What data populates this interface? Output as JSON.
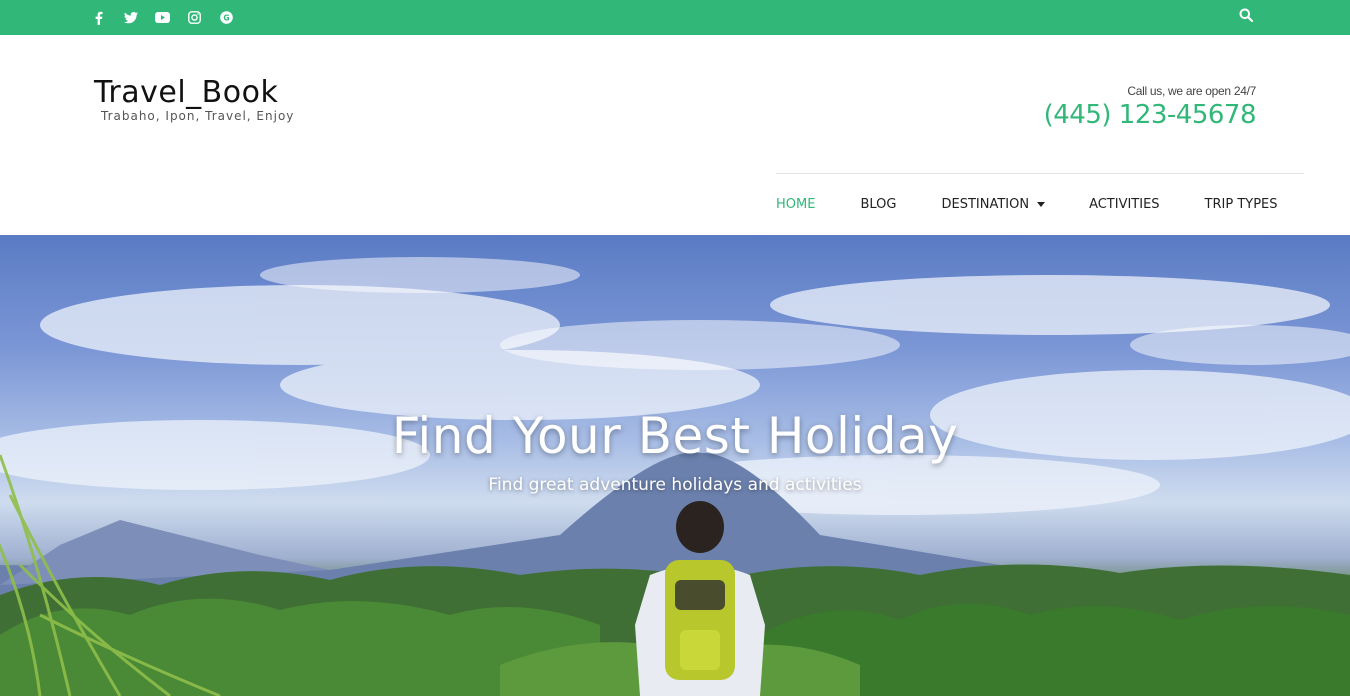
{
  "topbar": {
    "background": "#31b778",
    "social_icons": [
      "facebook-icon",
      "twitter-icon",
      "youtube-icon",
      "instagram-icon",
      "google-plus-icon"
    ],
    "search_icon": "search-icon"
  },
  "header": {
    "site_title": "Travel_Book",
    "tagline": "Trabaho, Ipon, Travel, Enjoy",
    "contact_label": "Call us, we are open 24/7",
    "phone": "(445) 123-45678",
    "accent_color": "#31b778"
  },
  "nav": {
    "items": [
      {
        "label": "HOME",
        "active": true
      },
      {
        "label": "BLOG",
        "active": false
      },
      {
        "label": "DESTINATION",
        "active": false,
        "dropdown": true
      },
      {
        "label": "ACTIVITIES",
        "active": false
      },
      {
        "label": "TRIP TYPES",
        "active": false
      }
    ]
  },
  "hero": {
    "title": "Find Your Best Holiday",
    "subtitle": "Find great adventure holidays and activities"
  }
}
